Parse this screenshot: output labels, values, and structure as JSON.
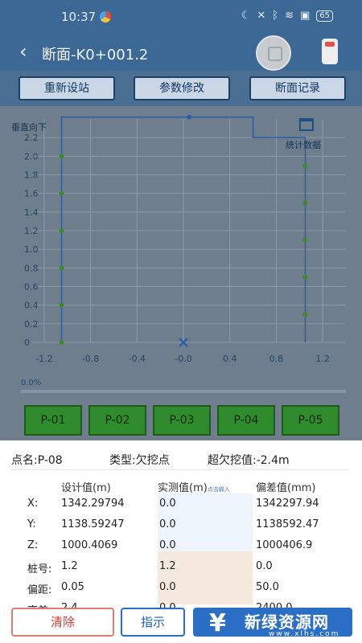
{
  "status_bar": {
    "time": "10:37",
    "battery": "65"
  },
  "header": {
    "title": "断面-K0+001.2"
  },
  "toolbar": {
    "reset_station": "重新设站",
    "modify_params": "参数修改",
    "section_records": "断面记录"
  },
  "plot": {
    "vertical_label": "垂直向下",
    "stats_label": "统计数据",
    "progress_text": "0.0%",
    "progress_value": 0.0,
    "x_ticks": [
      "-1.2",
      "-0.8",
      "-0.4",
      "-0.0",
      "0.4",
      "0.8",
      "1.2"
    ],
    "y_ticks": [
      "0",
      "0.2",
      "0.4",
      "0.6",
      "0.8",
      "1.0",
      "1.2",
      "1.4",
      "1.6",
      "1.8",
      "2.0",
      "2.2"
    ],
    "points": [
      {
        "x": -1.05,
        "y": 0
      },
      {
        "x": -1.05,
        "y": 0.4
      },
      {
        "x": -1.05,
        "y": 0.8
      },
      {
        "x": -1.05,
        "y": 1.2
      },
      {
        "x": -1.05,
        "y": 1.6
      },
      {
        "x": -1.05,
        "y": 2.0
      },
      {
        "x": 0.05,
        "y": 2.42
      },
      {
        "x": 1.05,
        "y": 0.3
      },
      {
        "x": 1.05,
        "y": 0.7
      },
      {
        "x": 1.05,
        "y": 1.1
      },
      {
        "x": 1.05,
        "y": 1.5
      },
      {
        "x": 1.05,
        "y": 1.9
      }
    ],
    "station_marker": {
      "x": 0.0,
      "y": 0.0
    },
    "colors": {
      "line": "#2a5fa8",
      "point": "#3c8a2c",
      "grid": "#8e9ba8",
      "axis_text": "#234565"
    }
  },
  "point_buttons": [
    "P-01",
    "P-02",
    "P-03",
    "P-04",
    "P-05"
  ],
  "details": {
    "point_name": "点名:P-08",
    "type": "类型:欠挖点",
    "over_under": "超欠挖值:-2.4m",
    "headers": {
      "design": "设计值(m)",
      "measured": "实测值(m)",
      "measured_hint": "点击输入",
      "deviation": "偏差值(mm)"
    },
    "rows": [
      {
        "label": "X:",
        "design": "1342.29794",
        "measured": "0.0",
        "deviation": "1342297.94"
      },
      {
        "label": "Y:",
        "design": "1138.59247",
        "measured": "0.0",
        "deviation": "1138592.47"
      },
      {
        "label": "Z:",
        "design": "1000.4069",
        "measured": "0.0",
        "deviation": "1000406.9"
      },
      {
        "label": "桩号:",
        "design": "1.2",
        "measured": "1.2",
        "deviation": "0.0"
      },
      {
        "label": "偏距:",
        "design": "0.05",
        "measured": "0.0",
        "deviation": "50.0"
      },
      {
        "label": "高差:",
        "design": "2.4",
        "measured": "0.0",
        "deviation": "2400.0"
      }
    ]
  },
  "actions": {
    "clear": "清除",
    "indicate": "指示"
  },
  "watermark": {
    "text": "新绿资源网",
    "url": "www.xlhs.com"
  }
}
